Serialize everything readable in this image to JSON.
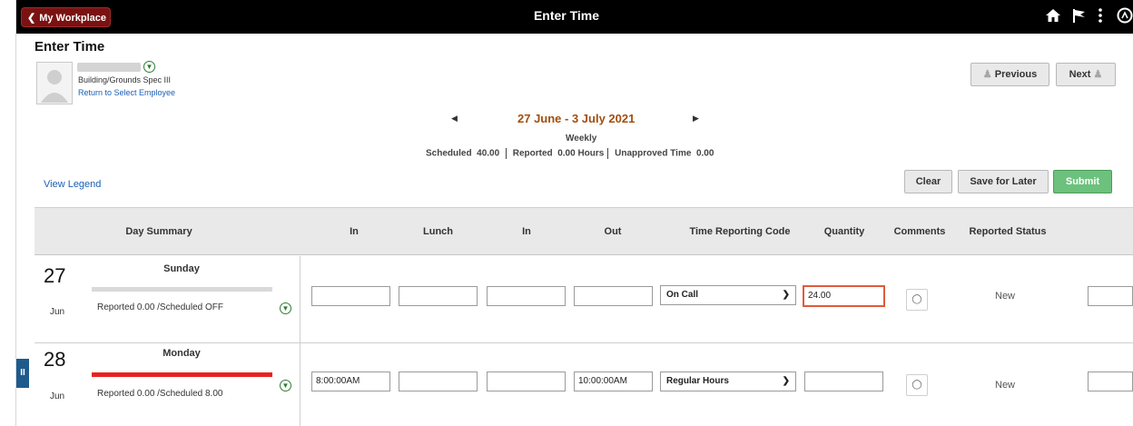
{
  "topbar": {
    "back_label": "My Workplace",
    "title": "Enter Time",
    "icons": [
      "home-icon",
      "flag-icon",
      "more-vert-icon",
      "navbar-icon"
    ]
  },
  "page": {
    "title": "Enter Time"
  },
  "employee": {
    "job_title": "Building/Grounds Spec III",
    "return_link": "Return to Select Employee"
  },
  "nav_buttons": {
    "previous": "Previous",
    "next": "Next"
  },
  "period": {
    "range": "27 June - 3 July 2021",
    "view": "Weekly",
    "scheduled_label": "Scheduled",
    "scheduled_value": "40.00",
    "reported_label": "Reported",
    "reported_value": "0.00 Hours",
    "unapproved_label": "Unapproved Time",
    "unapproved_value": "0.00"
  },
  "legend_link": "View Legend",
  "actions": {
    "clear": "Clear",
    "save": "Save for Later",
    "submit": "Submit"
  },
  "columns": [
    "Day Summary",
    "In",
    "Lunch",
    "In",
    "Out",
    "Time Reporting Code",
    "Quantity",
    "Comments",
    "Reported Status"
  ],
  "rows": [
    {
      "day": "27",
      "month": "Jun",
      "weekday": "Sunday",
      "summary": "Reported 0.00 /Scheduled OFF",
      "bar_color": "#d9d9d9",
      "in1": "",
      "lunch": "",
      "in2": "",
      "out": "",
      "trc": "On Call",
      "quantity": "24.00",
      "status": "New"
    },
    {
      "day": "28",
      "month": "Jun",
      "weekday": "Monday",
      "summary": "Reported 0.00 /Scheduled 8.00",
      "bar_color": "#e8231f",
      "in1": "8:00:00AM",
      "lunch": "",
      "in2": "",
      "out": "10:00:00AM",
      "trc": "Regular Hours",
      "quantity": "",
      "status": "New"
    }
  ],
  "colors": {
    "accent_red": "#7a1212",
    "submit_green": "#6cc17c",
    "period_text": "#a14e10",
    "link_blue": "#1a5fb4"
  }
}
